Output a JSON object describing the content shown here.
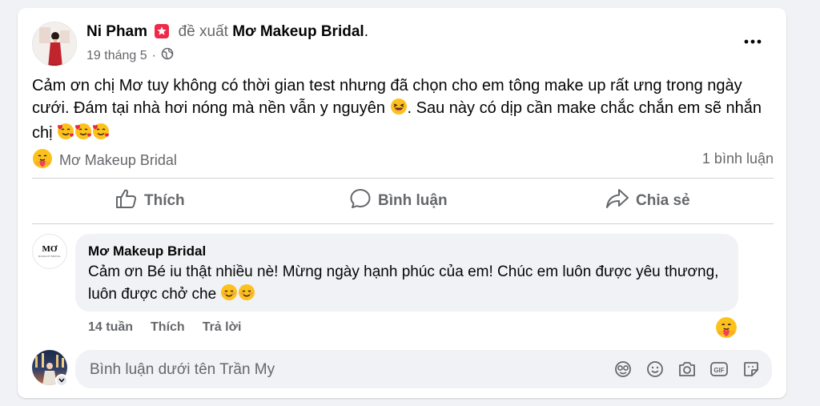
{
  "post": {
    "author": "Ni Pham",
    "recommend_text": "đề xuất",
    "page_name": "Mơ Makeup Bridal",
    "page_name_suffix": ".",
    "date": "19 tháng 5",
    "separator": "·",
    "text_part1": "Cảm ơn chị Mơ tuy không có thời gian test nhưng đã chọn cho em tông make up rất ưng trong ngày cưới. Đám tại nhà hơi nóng mà nền vẫn y nguyên ",
    "text_part2": ". Sau này có dịp cần make chắc chắn em sẽ nhắn chị "
  },
  "reactions": {
    "by": "Mơ Makeup Bridal",
    "comments_count": "1 bình luận"
  },
  "actions": {
    "like": "Thích",
    "comment": "Bình luận",
    "share": "Chia sẻ"
  },
  "comment": {
    "author": "Mơ Makeup Bridal",
    "avatar_text": "MƠ",
    "avatar_subtext": "MAKEUP BRIDAL",
    "text": "Cảm ơn Bé iu thật nhiều nè! Mừng ngày hạnh phúc của em! Chúc em luôn được yêu thương, luôn được chở che ",
    "time": "14 tuần",
    "like": "Thích",
    "reply": "Trả lời"
  },
  "composer": {
    "placeholder": "Bình luận dưới tên Trần My"
  },
  "colors": {
    "secondary_text": "#65676b",
    "badge": "#f02849",
    "background": "#f0f2f5"
  }
}
